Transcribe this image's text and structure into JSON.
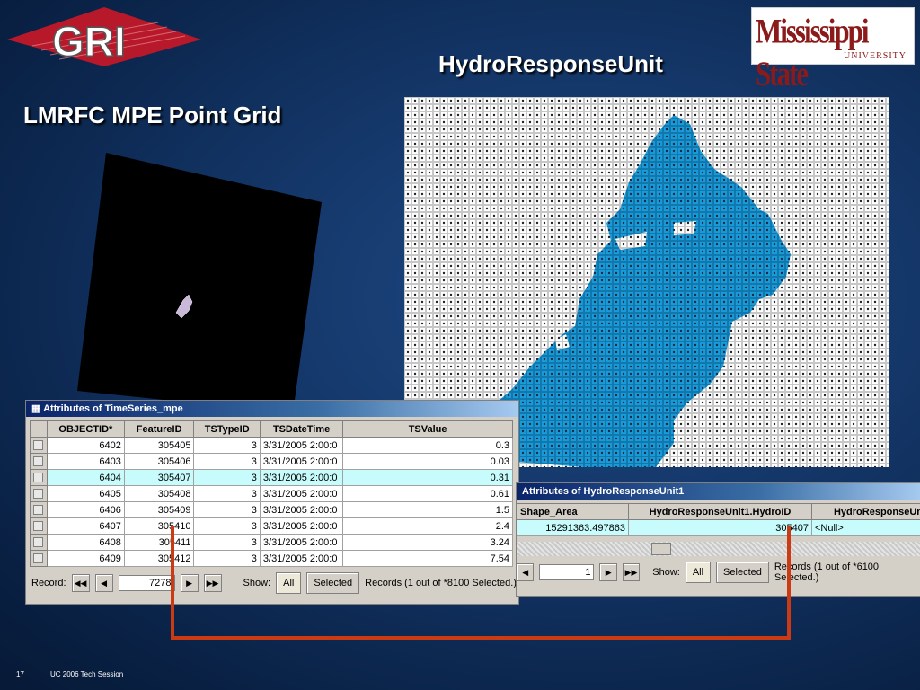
{
  "logos": {
    "gri": "GRI",
    "msu": "Mississippi State",
    "msu_sub": "UNIVERSITY"
  },
  "titles": {
    "hru": "HydroResponseUnit",
    "grid": "LMRFC MPE Point Grid"
  },
  "colors": {
    "accent_line": "#cc3a14",
    "map_fill": "#1a9ad6",
    "highlight_row": "#c8fcfc"
  },
  "ts_window": {
    "title": "Attributes of TimeSeries_mpe",
    "columns": [
      "OBJECTID*",
      "FeatureID",
      "TSTypeID",
      "TSDateTime",
      "TSValue"
    ],
    "rows": [
      [
        "6402",
        "305405",
        "3",
        "3/31/2005 2:00:0",
        "0.3"
      ],
      [
        "6403",
        "305406",
        "3",
        "3/31/2005 2:00:0",
        "0.03"
      ],
      [
        "6404",
        "305407",
        "3",
        "3/31/2005 2:00:0",
        "0.31"
      ],
      [
        "6405",
        "305408",
        "3",
        "3/31/2005 2:00:0",
        "0.61"
      ],
      [
        "6406",
        "305409",
        "3",
        "3/31/2005 2:00:0",
        "1.5"
      ],
      [
        "6407",
        "305410",
        "3",
        "3/31/2005 2:00:0",
        "2.4"
      ],
      [
        "6408",
        "305411",
        "3",
        "3/31/2005 2:00:0",
        "3.24"
      ],
      [
        "6409",
        "305412",
        "3",
        "3/31/2005 2:00:0",
        "7.54"
      ]
    ],
    "highlight_row_index": 2,
    "record_label": "Record:",
    "record_value": "7278",
    "show_label": "Show:",
    "all_label": "All",
    "selected_label": "Selected",
    "records_text": "Records (1 out of *8100 Selected.)"
  },
  "hru_window": {
    "title": "Attributes of HydroResponseUnit1",
    "columns": [
      "Shape_Area",
      "HydroResponseUnit1.HydroID",
      "HydroResponseUn"
    ],
    "rows": [
      [
        "15291363.497863",
        "305407",
        "<Null>"
      ]
    ],
    "record_value": "1",
    "show_label": "Show:",
    "all_label": "All",
    "selected_label": "Selected",
    "records_text": "Records (1 out of *6100 Selected.)"
  },
  "footer": {
    "page": "17",
    "session": "UC 2006 Tech Session"
  }
}
